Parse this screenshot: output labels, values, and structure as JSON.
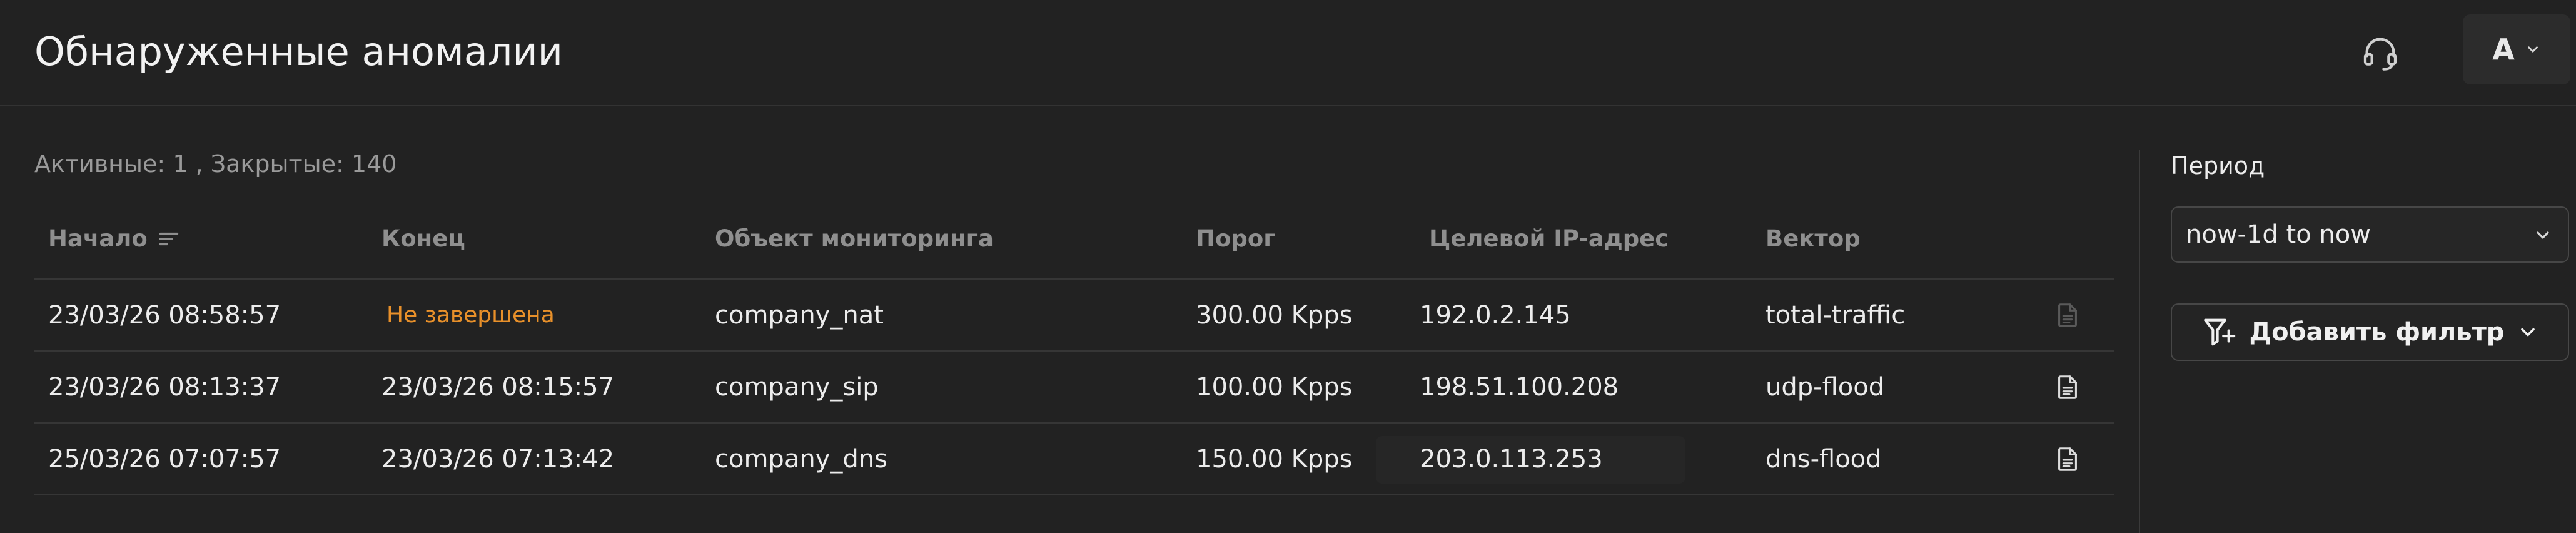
{
  "header": {
    "title": "Обнаруженные аномалии",
    "avatar_letter": "A"
  },
  "summary": {
    "active_label": "Активные:",
    "active_count": "1",
    "separator": ",",
    "closed_label": "Закрытые:",
    "closed_count": "140"
  },
  "table": {
    "columns": [
      "Начало",
      "Конец",
      "Объект мониторинга",
      "Порог",
      "Целевой IP-адрес",
      "Вектор"
    ],
    "rows": [
      {
        "start": "23/03/26 08:58:57",
        "end": "Не завершена",
        "end_status": "open",
        "object": "company_nat",
        "threshold": "300.00 Kpps",
        "ip": "192.0.2.145",
        "vector": "total-traffic",
        "report_enabled": false
      },
      {
        "start": "23/03/26 08:13:37",
        "end": "23/03/26 08:15:57",
        "end_status": "closed",
        "object": "company_sip",
        "threshold": "100.00 Kpps",
        "ip": "198.51.100.208",
        "vector": "udp-flood",
        "report_enabled": true
      },
      {
        "start": "25/03/26 07:07:57",
        "end": "23/03/26 07:13:42",
        "end_status": "closed",
        "object": "company_dns",
        "threshold": "150.00 Kpps",
        "ip": "203.0.113.253",
        "vector": "dns-flood",
        "report_enabled": true
      }
    ]
  },
  "filters": {
    "period_label": "Период",
    "period_value": "now-1d to now",
    "add_filter_label": "Добавить фильтр"
  },
  "colors": {
    "background": "#222222",
    "status_open": "#e8902a",
    "header_text": "#8f8f8f",
    "border": "#363636"
  },
  "icons": [
    "headset-icon",
    "chevron-down-icon",
    "sort-icon",
    "document-icon",
    "filter-plus-icon"
  ]
}
